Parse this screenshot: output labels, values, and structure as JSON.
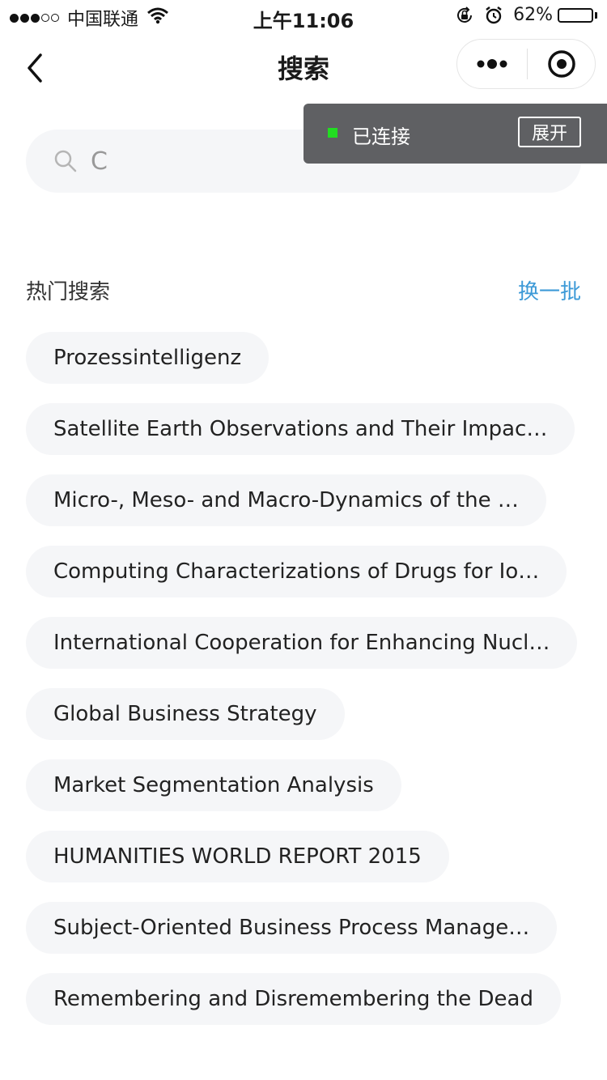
{
  "status_bar": {
    "carrier": "中国联通",
    "time": "上午11:06",
    "battery_text": "62%",
    "battery_level": 0.62
  },
  "nav": {
    "title": "搜索"
  },
  "search": {
    "value": "C"
  },
  "toast": {
    "status": "已连接",
    "button": "展开",
    "indicator_color": "#22dd22"
  },
  "hot": {
    "title": "热门搜索",
    "refresh_label": "换一批",
    "accent": "#3d9ad7",
    "items": [
      "Prozessintelligenz",
      "Satellite Earth Observations and Their Impac…",
      "Micro-, Meso- and Macro-Dynamics of the …",
      "Computing Characterizations of Drugs for Io…",
      "International Cooperation for Enhancing Nucl…",
      "Global Business Strategy",
      "Market Segmentation Analysis",
      "HUMANITIES WORLD REPORT 2015",
      "Subject-Oriented Business Process Manage…",
      "Remembering and Disremembering the Dead"
    ]
  },
  "icons": [
    "cellular-signal-icon",
    "wifi-icon",
    "rotation-lock-icon",
    "alarm-icon",
    "battery-icon",
    "back-icon",
    "more-icon",
    "close-mini-program-icon",
    "search-icon"
  ]
}
